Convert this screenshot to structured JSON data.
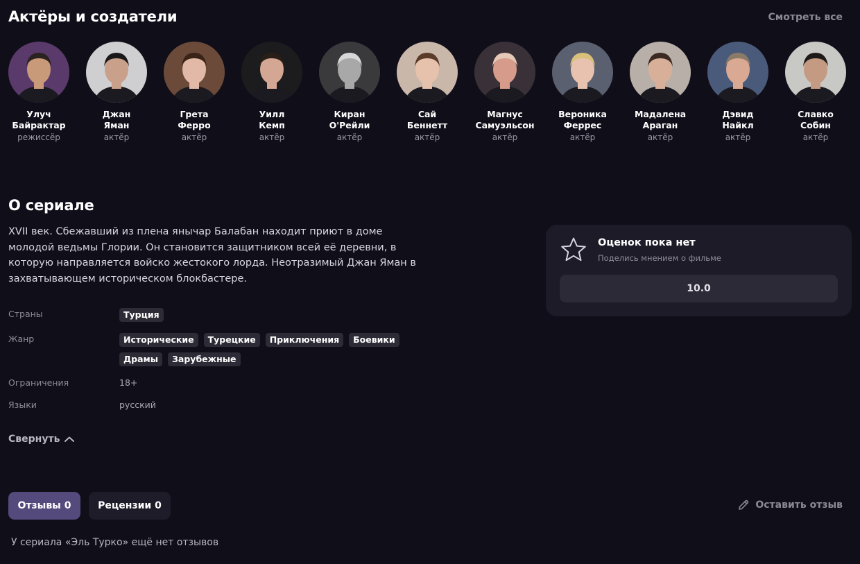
{
  "cast": {
    "title": "Актёры и создатели",
    "see_all": "Смотреть все",
    "people": [
      {
        "name": "Улуч\nБайрактар",
        "role": "режиссёр",
        "bg": "#5a3a6a",
        "skin": "#c99a7a",
        "hair": "#2a2220"
      },
      {
        "name": "Джан\nЯман",
        "role": "актёр",
        "bg": "#cfcfd2",
        "skin": "#c9a08a",
        "hair": "#1a1718"
      },
      {
        "name": "Грета\nФерро",
        "role": "актёр",
        "bg": "#6b4a3a",
        "skin": "#e2b9a6",
        "hair": "#3a2418"
      },
      {
        "name": "Уилл\nКемп",
        "role": "актёр",
        "bg": "#1c1c1e",
        "skin": "#d3a793",
        "hair": "#2a1e18"
      },
      {
        "name": "Киран\nО'Рейли",
        "role": "актёр",
        "bg": "#3a3a3c",
        "skin": "#a8a8a8",
        "hair": "#d8d8d8"
      },
      {
        "name": "Сай\nБеннетт",
        "role": "актёр",
        "bg": "#c9b7a9",
        "skin": "#e6c2ad",
        "hair": "#5a3a28"
      },
      {
        "name": "Магнус\nСамуэльсон",
        "role": "актёр",
        "bg": "#3a3038",
        "skin": "#d69b8a",
        "hair": "#e4c8b8"
      },
      {
        "name": "Вероника\nФеррес",
        "role": "актёр",
        "bg": "#5a6070",
        "skin": "#e8c2ae",
        "hair": "#d8c07a"
      },
      {
        "name": "Мадалена\nАраган",
        "role": "актёр",
        "bg": "#b8b0a8",
        "skin": "#d8b09a",
        "hair": "#3a2a22"
      },
      {
        "name": "Дэвид\nНайкл",
        "role": "актёр",
        "bg": "#4a5a7a",
        "skin": "#d9a994",
        "hair": "#8a7a68"
      },
      {
        "name": "Славко\nСобин",
        "role": "актёр",
        "bg": "#c8c8c4",
        "skin": "#c49a82",
        "hair": "#1e1a18"
      }
    ]
  },
  "about": {
    "title": "О сериале",
    "description": "XVII век. Сбежавший из плена янычар Балабан находит приют в доме молодой ведьмы Глории. Он становится защитником всей её деревни, в которую направляется войско жестокого лорда. Неотразимый Джан Яман в захватывающем историческом блокбастере.",
    "countries_label": "Страны",
    "countries": [
      "Турция"
    ],
    "genre_label": "Жанр",
    "genres": [
      "Исторические",
      "Турецкие",
      "Приключения",
      "Боевики",
      "Драмы",
      "Зарубежные"
    ],
    "restrictions_label": "Ограничения",
    "restrictions": "18+",
    "languages_label": "Языки",
    "languages": "русский",
    "collapse": "Свернуть"
  },
  "rating": {
    "title": "Оценок пока нет",
    "subtitle": "Поделись мнением о фильме",
    "button": "10.0"
  },
  "reviews": {
    "tab_reviews": "Отзывы 0",
    "tab_critics": "Рецензии 0",
    "leave_review": "Оставить отзыв",
    "empty": "У сериала «Эль Турко» ещё нет отзывов"
  },
  "colors": {
    "background": "#100e19",
    "card": "#1e1b29",
    "accent_tab": "#544a7c",
    "tag": "#2d2b36"
  },
  "icons": [
    "star-icon",
    "chevron-up-icon",
    "pencil-icon"
  ]
}
